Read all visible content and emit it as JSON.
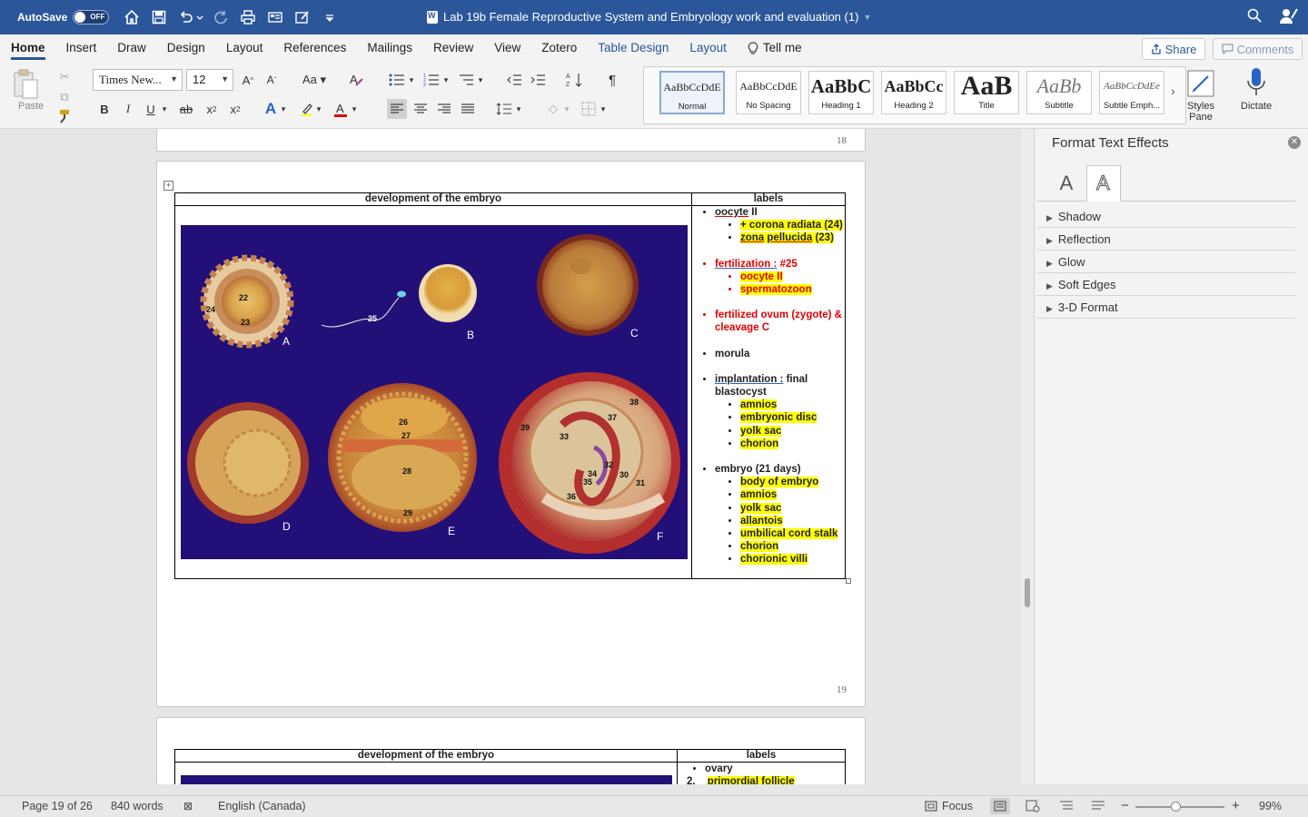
{
  "titlebar": {
    "autosave_label": "AutoSave",
    "autosave_state": "OFF",
    "doc_title": "Lab 19b Female Reproductive System and Embryology work and evaluation (1)"
  },
  "menu": {
    "items": [
      "Home",
      "Insert",
      "Draw",
      "Design",
      "Layout",
      "References",
      "Mailings",
      "Review",
      "View",
      "Zotero",
      "Table Design",
      "Layout"
    ],
    "tell_me": "Tell me",
    "share": "Share",
    "comments": "Comments"
  },
  "ribbon": {
    "paste_label": "Paste",
    "font_name": "Times New...",
    "font_size": "12",
    "styles": [
      {
        "sample": "AaBbCcDdE",
        "name": "Normal"
      },
      {
        "sample": "AaBbCcDdE",
        "name": "No Spacing"
      },
      {
        "sample": "AaBbC",
        "name": "Heading 1"
      },
      {
        "sample": "AaBbCc",
        "name": "Heading 2"
      },
      {
        "sample": "AaB",
        "name": "Title"
      },
      {
        "sample": "AaBb",
        "name": "Subtitle"
      },
      {
        "sample": "AaBbCcDdEe",
        "name": "Subtle Emph..."
      }
    ],
    "styles_pane_label": "Styles Pane",
    "dictate_label": "Dictate"
  },
  "document": {
    "page18_number": "18",
    "page19_number": "19",
    "table": {
      "col1_header": "development of the embryo",
      "col2_header": "labels"
    },
    "figure": {
      "letters": [
        "A",
        "B",
        "C",
        "D",
        "E",
        "F"
      ],
      "numbers": [
        "22",
        "24",
        "23",
        "25",
        "26",
        "27",
        "28",
        "29",
        "38",
        "37",
        "39",
        "33",
        "32",
        "30",
        "34",
        "35",
        "31",
        "36"
      ]
    },
    "labels": {
      "oocyte": "oocyte",
      "oocyte_suffix": " II",
      "corona": "+ corona radiata (24)",
      "zona_a": "zona",
      "zona_b": "pellucida",
      "zona_c": " (23)",
      "fert_a": "fertilization :",
      "fert_b": " #25",
      "fert_sub1": "oocyte II",
      "fert_sub2": "spermatozoon",
      "zygote": "fertilized ovum (zygote) & cleavage C",
      "morula": "morula",
      "impl_a": "implantation :",
      "impl_b": " final blastocyst",
      "impl_sub": [
        "amnios",
        "embryonic disc",
        "yolk sac",
        "chorion"
      ],
      "embryo": "embryo (21 days)",
      "embryo_sub": [
        "body of embryo",
        "amnios",
        "yolk sac",
        "allantois",
        "umbilical cord stalk",
        "chorion",
        "chorionic villi"
      ]
    },
    "page20": {
      "col1_header": "development of the embryo",
      "col2_header": "labels",
      "item1": "ovary",
      "item2_num": "2.",
      "item2": "primordial follicle"
    }
  },
  "format_pane": {
    "title": "Format Text Effects",
    "tab_fill_glyph": "A",
    "tab_effects_glyph": "A",
    "sections": [
      "Shadow",
      "Reflection",
      "Glow",
      "Soft Edges",
      "3-D Format"
    ]
  },
  "statusbar": {
    "page": "Page 19 of 26",
    "words": "840 words",
    "language": "English (Canada)",
    "focus": "Focus",
    "zoom": "99%",
    "zoom_fraction": 0.45
  },
  "colors": {
    "brand": "#2b579a",
    "highlight": "#ffff00",
    "red_text": "#e30000",
    "figure_bg": "#230f78"
  }
}
